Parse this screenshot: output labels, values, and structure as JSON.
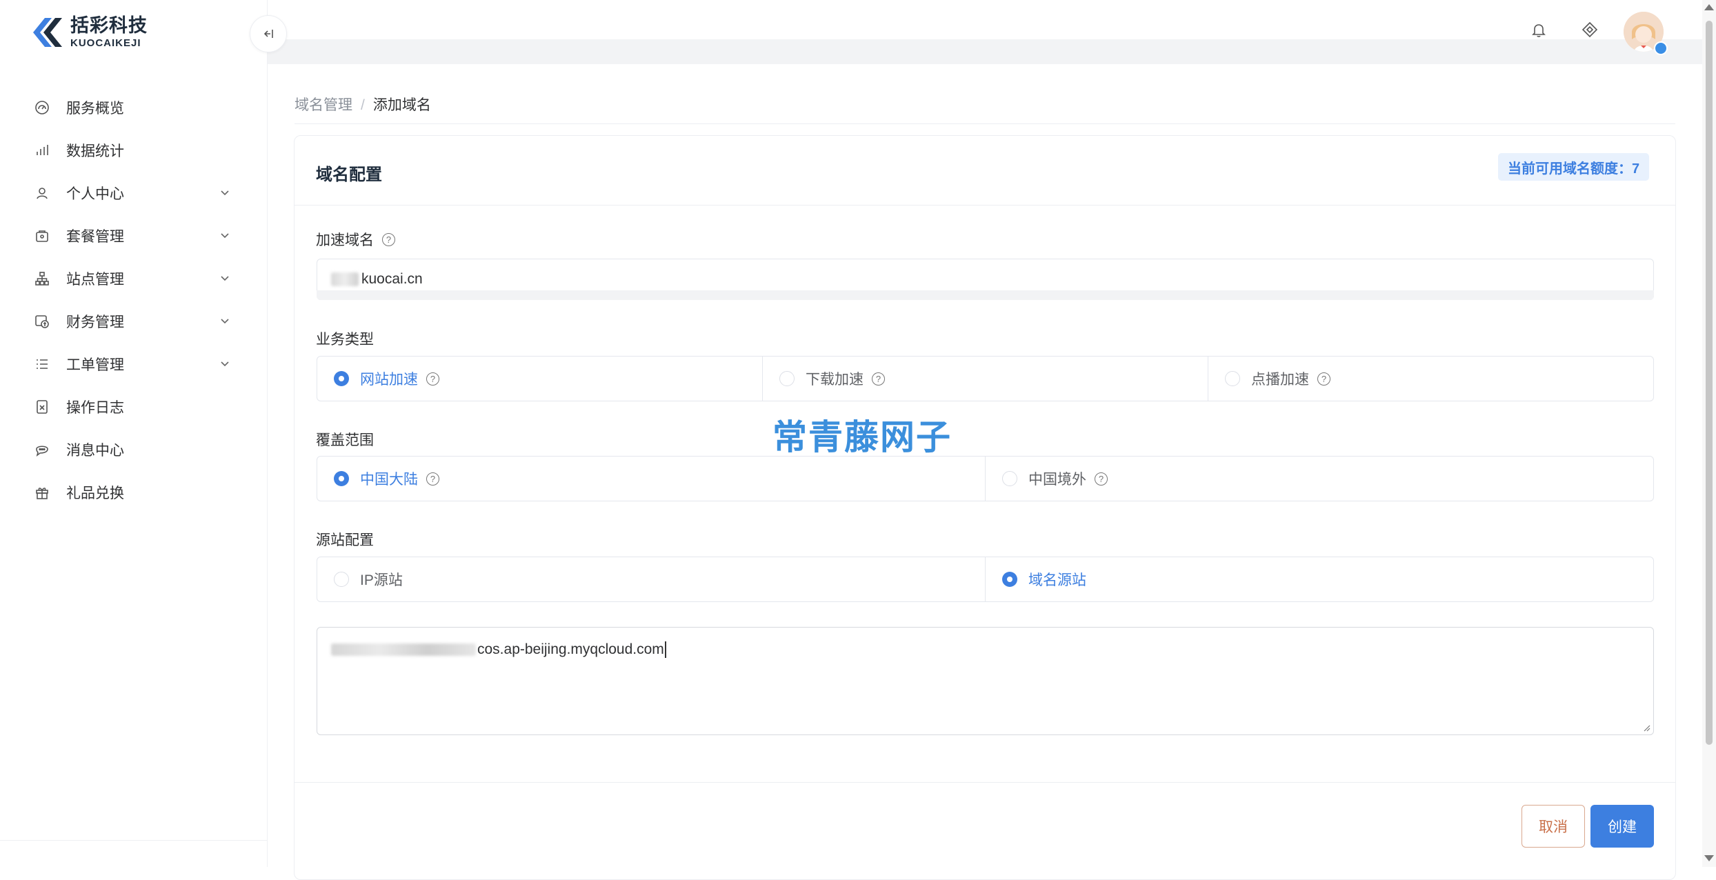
{
  "brand": {
    "name_cn": "括彩科技",
    "name_en": "KUOCAIKEJI",
    "accent": "#3d7fe0"
  },
  "sidebar": {
    "collapse_icon": "collapse-left-icon",
    "items": [
      {
        "label": "服务概览",
        "icon": "dashboard-icon",
        "expandable": false
      },
      {
        "label": "数据统计",
        "icon": "bar-chart-icon",
        "expandable": false
      },
      {
        "label": "个人中心",
        "icon": "user-icon",
        "expandable": true
      },
      {
        "label": "套餐管理",
        "icon": "package-icon",
        "expandable": true
      },
      {
        "label": "站点管理",
        "icon": "sitemap-icon",
        "expandable": true
      },
      {
        "label": "财务管理",
        "icon": "finance-icon",
        "expandable": true
      },
      {
        "label": "工单管理",
        "icon": "list-icon",
        "expandable": true
      },
      {
        "label": "操作日志",
        "icon": "log-icon",
        "expandable": false
      },
      {
        "label": "消息中心",
        "icon": "message-icon",
        "expandable": false
      },
      {
        "label": "礼品兑换",
        "icon": "gift-icon",
        "expandable": false
      }
    ]
  },
  "header": {
    "icons": [
      "bell-icon",
      "diamond-icon",
      "avatar"
    ]
  },
  "breadcrumb": {
    "parent": "域名管理",
    "separator": "/",
    "current": "添加域名"
  },
  "card": {
    "title": "域名配置",
    "quota_label": "当前可用域名额度：7",
    "domain": {
      "label": "加速域名",
      "value": "kuocai.cn"
    },
    "business_type": {
      "label": "业务类型",
      "options": [
        {
          "label": "网站加速",
          "checked": true
        },
        {
          "label": "下载加速",
          "checked": false
        },
        {
          "label": "点播加速",
          "checked": false
        }
      ]
    },
    "coverage": {
      "label": "覆盖范围",
      "options": [
        {
          "label": "中国大陆",
          "checked": true
        },
        {
          "label": "中国境外",
          "checked": false
        }
      ]
    },
    "origin": {
      "label": "源站配置",
      "options": [
        {
          "label": "IP源站",
          "checked": false
        },
        {
          "label": "域名源站",
          "checked": true
        }
      ],
      "value": "cos.ap-beijing.myqcloud.com"
    },
    "buttons": {
      "cancel": "取消",
      "create": "创建"
    }
  },
  "watermark": "常青藤网子"
}
